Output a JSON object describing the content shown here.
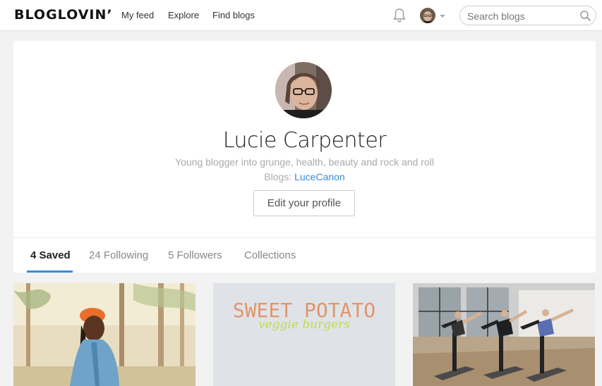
{
  "header": {
    "logo": "BLOGLOVIN’",
    "nav": [
      "My feed",
      "Explore",
      "Find blogs"
    ],
    "search_placeholder": "Search blogs",
    "icons": [
      "bell-icon",
      "avatar",
      "chevron-down-icon",
      "search-icon"
    ]
  },
  "profile": {
    "name": "Lucie Carpenter",
    "bio": "Young blogger into grunge, health, beauty and rock and roll",
    "blogs_label": "Blogs:",
    "blog_link": "LuceCanon",
    "edit_button": "Edit your profile"
  },
  "tabs": [
    {
      "label": "4 Saved",
      "active": true
    },
    {
      "label": "24 Following",
      "active": false
    },
    {
      "label": "5 Followers",
      "active": false
    },
    {
      "label": "Collections",
      "active": false
    }
  ],
  "posts": [
    {
      "image": "woman-in-orange-beret"
    },
    {
      "image": "sweet-potato-text",
      "title_text": "SWEET POTATO",
      "subtitle_text": "veggie burgers"
    },
    {
      "image": "yoga-class"
    }
  ],
  "colors": {
    "accent": "#3b8bd6",
    "background": "#f2f2f2",
    "sweet_potato_orange": "#e2956a",
    "veggie_green": "#c7d94a"
  }
}
